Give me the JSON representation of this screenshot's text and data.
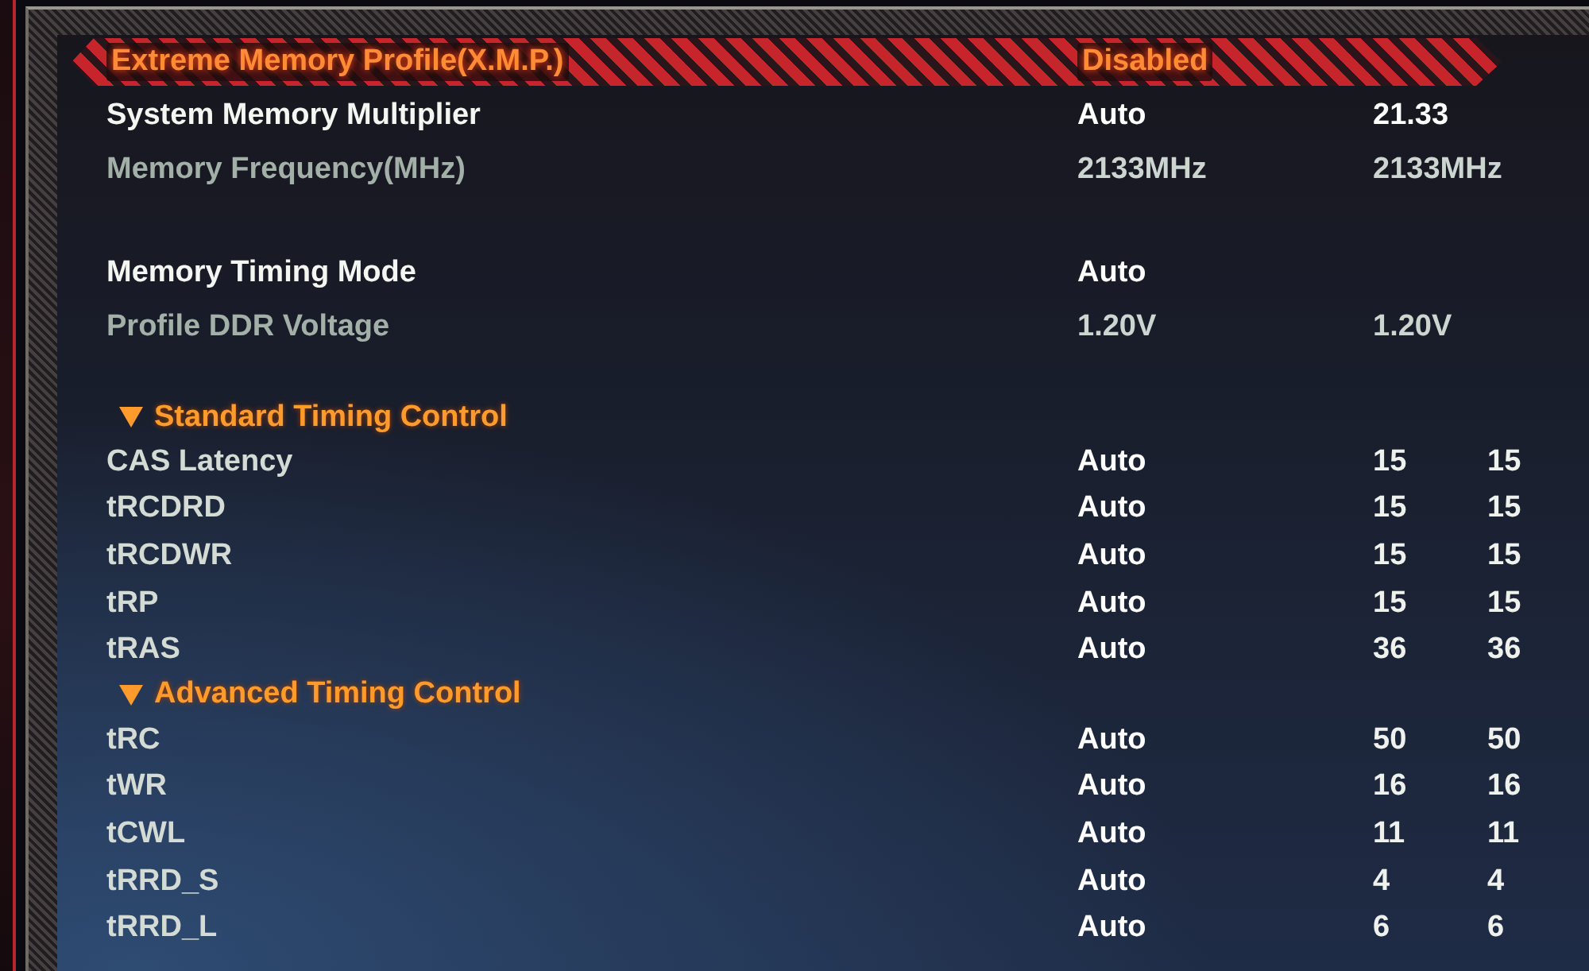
{
  "setting_groups": [
    [
      {
        "kind": "option",
        "label": "Extreme Memory Profile(X.M.P.)",
        "value": "Disabled",
        "selected": true
      },
      {
        "kind": "option",
        "label": "System Memory Multiplier",
        "value": "Auto",
        "readings": [
          "21.33"
        ],
        "selected": false
      },
      {
        "kind": "info",
        "label": "Memory Frequency(MHz)",
        "value": "2133MHz",
        "readings": [
          "2133MHz"
        ],
        "selected": false
      }
    ],
    [
      {
        "kind": "option",
        "label": "Memory Timing Mode",
        "value": "Auto",
        "selected": false
      },
      {
        "kind": "info",
        "label": "Profile DDR Voltage",
        "value": "1.20V",
        "readings": [
          "1.20V"
        ],
        "selected": false
      }
    ]
  ],
  "sections": [
    {
      "title": "Standard Timing Control",
      "expanded": true,
      "rows": [
        {
          "label": "CAS Latency",
          "value": "Auto",
          "readings": [
            "15",
            "15"
          ],
          "selected": false
        },
        {
          "label": "tRCDRD",
          "value": "Auto",
          "readings": [
            "15",
            "15"
          ],
          "selected": false
        },
        {
          "label": "tRCDWR",
          "value": "Auto",
          "readings": [
            "15",
            "15"
          ],
          "selected": false
        },
        {
          "label": "tRP",
          "value": "Auto",
          "readings": [
            "15",
            "15"
          ],
          "selected": false
        },
        {
          "label": "tRAS",
          "value": "Auto",
          "readings": [
            "36",
            "36"
          ],
          "selected": false
        }
      ]
    },
    {
      "title": "Advanced Timing Control",
      "expanded": true,
      "rows": [
        {
          "label": "tRC",
          "value": "Auto",
          "readings": [
            "50",
            "50"
          ],
          "selected": false
        },
        {
          "label": "tWR",
          "value": "Auto",
          "readings": [
            "16",
            "16"
          ],
          "selected": false
        },
        {
          "label": "tCWL",
          "value": "Auto",
          "readings": [
            "11",
            "11"
          ],
          "selected": false
        },
        {
          "label": "tRRD_S",
          "value": "Auto",
          "readings": [
            "4",
            "4"
          ],
          "selected": false
        },
        {
          "label": "tRRD_L",
          "value": "Auto",
          "readings": [
            "6",
            "6"
          ],
          "selected": false
        }
      ]
    }
  ]
}
